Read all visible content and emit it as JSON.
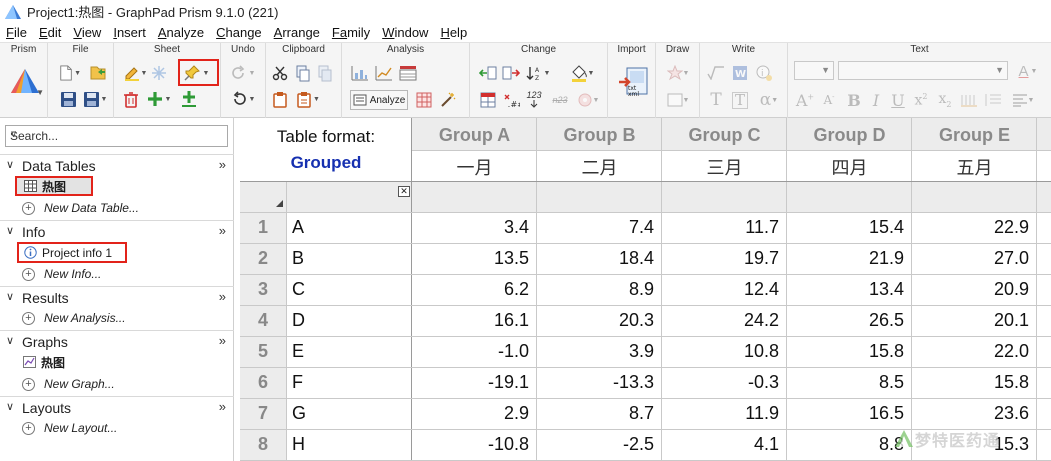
{
  "window": {
    "title": "Project1:热图 - GraphPad Prism 9.1.0 (221)"
  },
  "menu": [
    {
      "mnemonic": "F",
      "rest": "ile"
    },
    {
      "mnemonic": "E",
      "rest": "dit"
    },
    {
      "mnemonic": "V",
      "rest": "iew"
    },
    {
      "mnemonic": "I",
      "rest": "nsert"
    },
    {
      "mnemonic": "A",
      "rest": "nalyze"
    },
    {
      "mnemonic": "C",
      "rest": "hange"
    },
    {
      "mnemonic": "A",
      "rest": "rrange"
    },
    {
      "mnemonic": "Fa",
      "rest": "mily"
    },
    {
      "mnemonic": "W",
      "rest": "indow"
    },
    {
      "mnemonic": "H",
      "rest": "elp"
    }
  ],
  "ribbon": {
    "groups": {
      "prism": "Prism",
      "file": "File",
      "sheet": "Sheet",
      "undo": "Undo",
      "clipboard": "Clipboard",
      "analysis": "Analysis",
      "change": "Change",
      "import": "Import",
      "draw": "Draw",
      "write": "Write",
      "text": "Text"
    },
    "analyze_label": "Analyze",
    "change_123": "123",
    "change_n23": "n23",
    "import_icon_text": "txt\nxml",
    "highlight_color": "#e2231a"
  },
  "navigator": {
    "search_placeholder": "Search...",
    "sections": {
      "data_tables": {
        "name": "Data Tables",
        "items": [
          "热图"
        ],
        "new": "New Data Table..."
      },
      "info": {
        "name": "Info",
        "items": [
          "Project info 1"
        ],
        "new": "New Info..."
      },
      "results": {
        "name": "Results",
        "new": "New Analysis..."
      },
      "graphs": {
        "name": "Graphs",
        "items": [
          "热图"
        ],
        "new": "New Graph..."
      },
      "layouts": {
        "name": "Layouts",
        "new": "New Layout..."
      }
    },
    "chevron": "∨",
    "more": "»"
  },
  "table": {
    "format_label": "Table format:",
    "format_value": "Grouped",
    "format_color": "#1630b0",
    "columns": [
      {
        "title": "Group A",
        "sub": "一月"
      },
      {
        "title": "Group B",
        "sub": "二月"
      },
      {
        "title": "Group C",
        "sub": "三月"
      },
      {
        "title": "Group D",
        "sub": "四月"
      },
      {
        "title": "Group E",
        "sub": "五月"
      }
    ],
    "rows": [
      {
        "num": "1",
        "label": "A",
        "values": [
          "3.4",
          "7.4",
          "11.7",
          "15.4",
          "22.9"
        ]
      },
      {
        "num": "2",
        "label": "B",
        "values": [
          "13.5",
          "18.4",
          "19.7",
          "21.9",
          "27.0"
        ]
      },
      {
        "num": "3",
        "label": "C",
        "values": [
          "6.2",
          "8.9",
          "12.4",
          "13.4",
          "20.9"
        ]
      },
      {
        "num": "4",
        "label": "D",
        "values": [
          "16.1",
          "20.3",
          "24.2",
          "26.5",
          "20.1"
        ]
      },
      {
        "num": "5",
        "label": "E",
        "values": [
          "-1.0",
          "3.9",
          "10.8",
          "15.8",
          "22.0"
        ]
      },
      {
        "num": "6",
        "label": "F",
        "values": [
          "-19.1",
          "-13.3",
          "-0.3",
          "8.5",
          "15.8"
        ]
      },
      {
        "num": "7",
        "label": "G",
        "values": [
          "2.9",
          "8.7",
          "11.9",
          "16.5",
          "23.6"
        ]
      },
      {
        "num": "8",
        "label": "H",
        "values": [
          "-10.8",
          "-2.5",
          "4.1",
          "8.8",
          "15.3"
        ]
      }
    ]
  },
  "watermark": "梦特医药通"
}
